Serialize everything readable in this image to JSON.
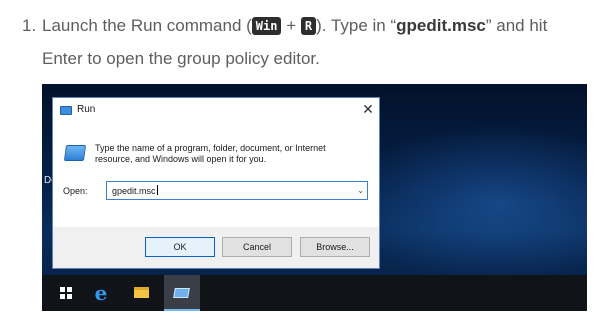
{
  "instruction": {
    "number": "1.",
    "text_before": "Launch the Run command (",
    "key_win": "Win",
    "plus": "+",
    "key_r": "R",
    "text_after_keys": "). Type in “",
    "command": "gpedit.msc",
    "text_end": "” and hit Enter to open the group policy editor."
  },
  "desktop": {
    "partial_label": "De"
  },
  "run_dialog": {
    "title": "Run",
    "close_glyph": "✕",
    "message": "Type the name of a program, folder, document, or Internet resource, and Windows will open it for you.",
    "open_label": "Open:",
    "open_value": "gpedit.msc",
    "dropdown_glyph": "⌄",
    "buttons": {
      "ok": "OK",
      "cancel": "Cancel",
      "browse": "Browse..."
    }
  },
  "taskbar": {
    "items": [
      "windows-start",
      "edge",
      "file-explorer",
      "run"
    ],
    "edge_glyph": "e"
  },
  "colors": {
    "desktop_bg": "#06224a",
    "taskbar_bg": "#101318",
    "key_bg": "#2e2e2e",
    "accent": "#0a64c8"
  }
}
